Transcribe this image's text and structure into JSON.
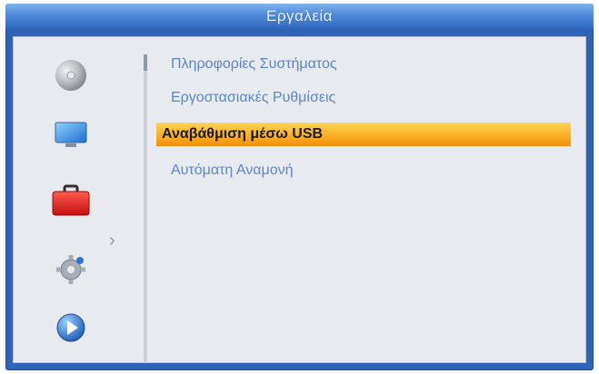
{
  "header": {
    "title": "Εργαλεία"
  },
  "sidebar": {
    "items": [
      {
        "icon": "disc-icon"
      },
      {
        "icon": "monitor-icon"
      },
      {
        "icon": "toolbox-icon",
        "selected": true
      },
      {
        "icon": "gear-icon"
      },
      {
        "icon": "play-icon"
      }
    ]
  },
  "menu": {
    "items": [
      {
        "label": "Πληροφορίες Συστήματος"
      },
      {
        "label": "Εργοστασιακές Ρυθμίσεις"
      },
      {
        "label": "Αναβάθμιση μέσω USB",
        "selected": true
      },
      {
        "label": "Αυτόματη Αναμονή"
      }
    ]
  },
  "colors": {
    "frame_blue": "#2e63b8",
    "highlight_orange": "#fbaf24",
    "menu_text_blue": "#5f86c4",
    "panel_gray": "#e7ebef"
  }
}
